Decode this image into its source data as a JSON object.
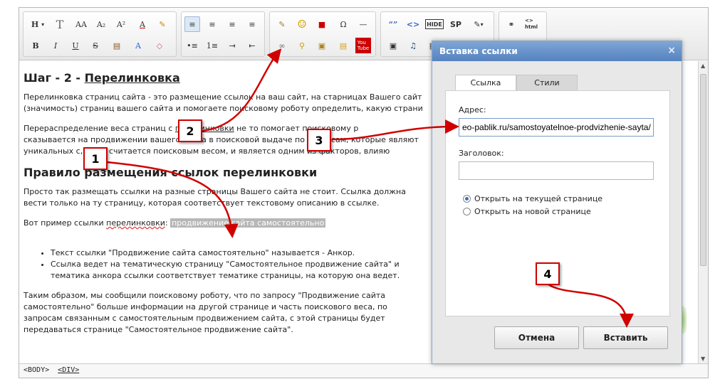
{
  "toolbar": {
    "g1": [
      "H",
      "T",
      "AA",
      "A₂",
      "A²",
      "A",
      "✎",
      "B",
      "I",
      "U",
      "S",
      "▤",
      "A",
      "◇"
    ],
    "g2": [
      "≡",
      "≡",
      "≡",
      "≡",
      "•≡",
      "1≡",
      "⇥",
      "⇤"
    ],
    "g3": [
      "✎",
      "☺",
      "■",
      "Ω",
      "—",
      "∞",
      "⚲",
      "▣",
      "▤",
      "You\nTube"
    ],
    "g4": [
      "“”",
      "<>",
      "HIDE",
      "SP",
      "✎",
      "▣",
      "♫",
      "▤"
    ],
    "g5": [
      "⚭",
      "<>\nhtml"
    ]
  },
  "content": {
    "h1_prefix": "Шаг - 2 - ",
    "h1_link": "Перелинковка",
    "p1": "Перелинковка страниц сайта - это размещение ссылок на ваш сайт, на старницах Вашего сайт",
    "p1_tail": "с",
    "p1b": "(значимость) страниц вашего сайта и помогаете поисковому роботу определить, какую страни",
    "p2a": "Перераспределение веса страниц с",
    "p2a_link": "перелинковки",
    "p2a_mid": "не то",
    "p2a_tail": "помогает поисковому р",
    "p2a_end": "о",
    "p2b": "сказывается на продвижении вашего сайта в поисковой выдаче по запросам, которые являют",
    "p2c": "уникальных с",
    "p2c_tail": ", тоже считается поисковым весом, и является одним из факторов, влияю",
    "h2": "Правило размещения ссылок перелинковки",
    "p3": "Просто так размещать ссылки на разные страницы Вашего сайта не стоит. Ссылка должна вести только на ту страницу, которая соответствует текстовому описанию в ссылке.",
    "p4_prefix": "Вот пример ссылки ",
    "p4_link": "перелинковки",
    "p4_hl": "продвижение сайта самостоятельно",
    "li1": "Текст ссылки \"Продвижение сайта самостоятельно\" называется - Анкор.",
    "li2": "Ссылка ведет на тематическую страницу \"Самостоятельное продвижение сайта\" и тематика анкора ссылки соответствует тематике страницы, на которую она ведет.",
    "p5": "Таким образом, мы сообщили поисковому роботу, что по запросу \"Продвижение сайта самостоятельно\" больше информации на другой странице и часть поискового веса, по запросам связанным с самостоятельным продвижением сайта, с этой страницы будет передаваться странице \"Самостоятельное продвижение сайта\"."
  },
  "statusbar": {
    "body_tag": "<BODY>",
    "div_tag": "<DIV>"
  },
  "dialog": {
    "title": "Вставка ссылки",
    "close": "×",
    "tab_link": "Ссылка",
    "tab_styles": "Стили",
    "address_label": "Адрес:",
    "address_value": "eo-pablik.ru/samostoyatelnoe-prodvizhenie-sayta/",
    "title_label": "Заголовок:",
    "title_value": "",
    "radio_current": "Открыть на текущей странице",
    "radio_new": "Открыть на новой странице",
    "radio_selected": "current",
    "cancel_button": "Отмена",
    "insert_button": "Вставить"
  },
  "badges": [
    "1",
    "2",
    "3",
    "4"
  ],
  "colors": {
    "badge_border": "#c00000",
    "arrow": "#d10000",
    "dialog_title": "#6690c8"
  }
}
